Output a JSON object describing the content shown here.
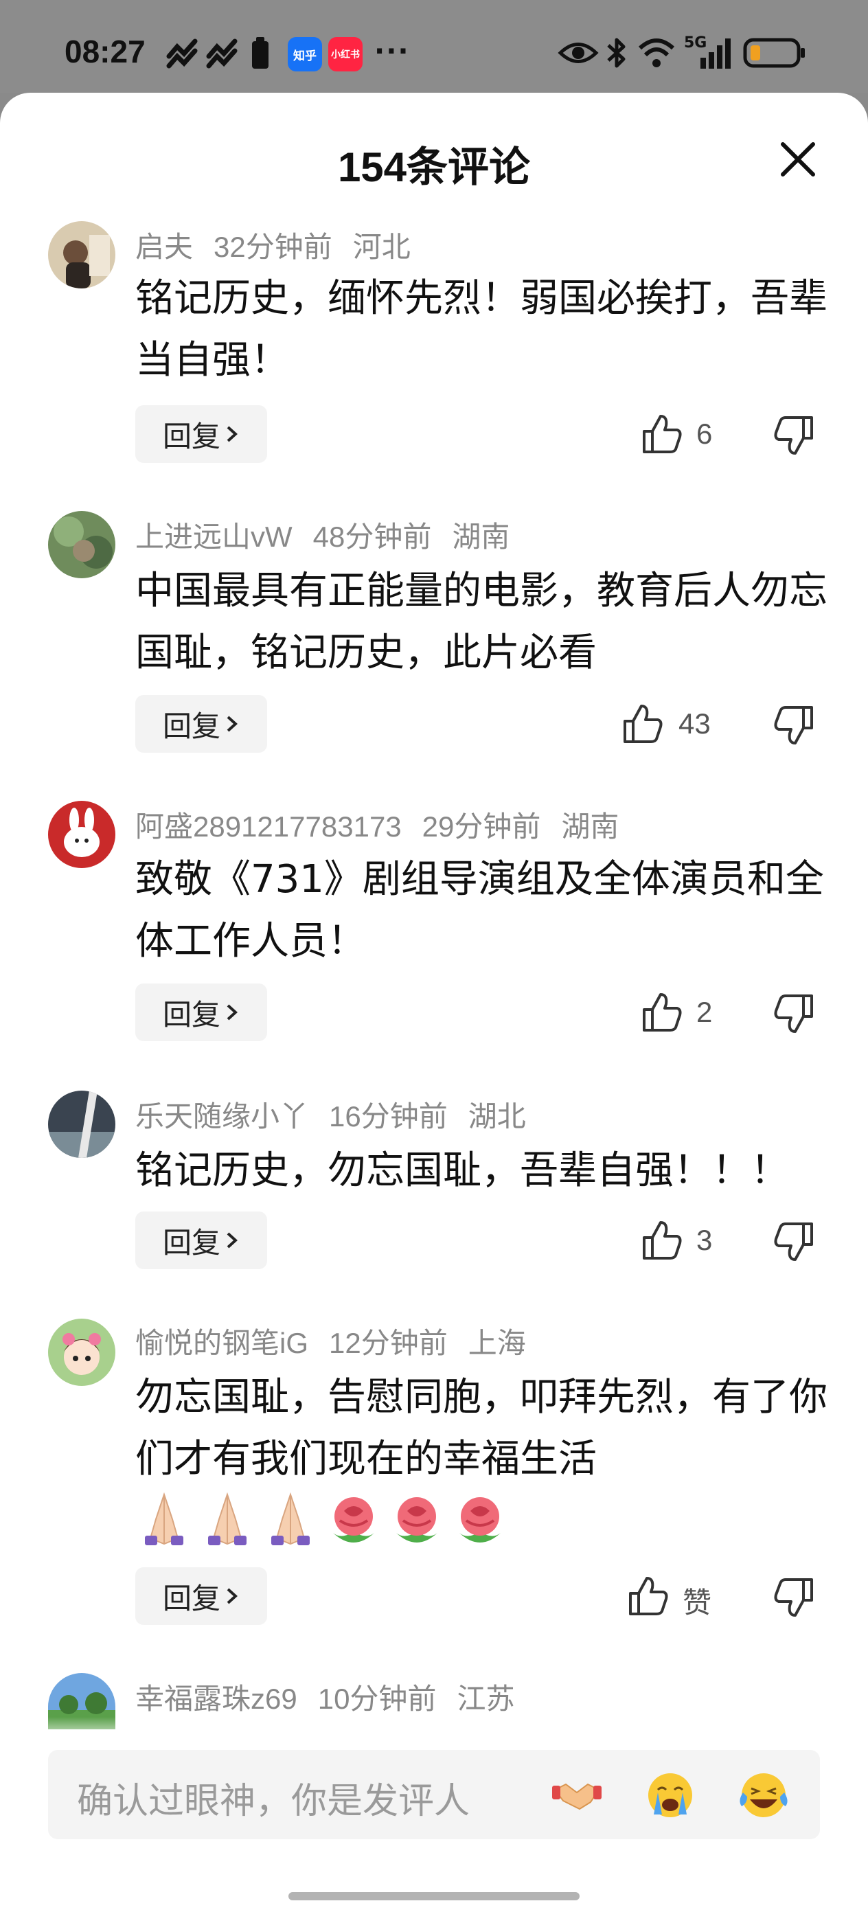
{
  "status_bar": {
    "time": "08:27",
    "badges": [
      {
        "label": "知乎",
        "color": "#1772f6"
      },
      {
        "label": "小红书",
        "color": "#ff2442"
      }
    ],
    "more": "···",
    "icons": [
      "eye-icon",
      "bluetooth-icon",
      "wifi-icon",
      "signal-5g-icon",
      "battery-icon"
    ],
    "network": "5G"
  },
  "sheet": {
    "title": "154条评论"
  },
  "comments": [
    {
      "user": "启夫",
      "time": "32分钟前",
      "region": "河北",
      "text": "铭记历史，缅怀先烈！弱国必挨打，吾辈当自强！",
      "reply_label": "回复",
      "likes": "6"
    },
    {
      "user": "上进远山vW",
      "time": "48分钟前",
      "region": "湖南",
      "text": "中国最具有正能量的电影，教育后人勿忘国耻，铭记历史，此片必看",
      "reply_label": "回复",
      "likes": "43"
    },
    {
      "user": "阿盛2891217783173",
      "time": "29分钟前",
      "region": "湖南",
      "text": "致敬《731》剧组导演组及全体演员和全体工作人员！",
      "reply_label": "回复",
      "likes": "2"
    },
    {
      "user": "乐天随缘小丫",
      "time": "16分钟前",
      "region": "湖北",
      "text": "铭记历史，勿忘国耻，吾辈自强！！！",
      "reply_label": "回复",
      "likes": "3"
    },
    {
      "user": "愉悦的钢笔iG",
      "time": "12分钟前",
      "region": "上海",
      "text": "勿忘国耻，告慰同胞，叩拜先烈，有了你们才有我们现在的幸福生活",
      "emojis": [
        "praying-hands",
        "praying-hands",
        "praying-hands",
        "rose",
        "rose",
        "rose"
      ],
      "reply_label": "回复",
      "likes": "赞"
    },
    {
      "user": "幸福露珠z69",
      "time": "10分钟前",
      "region": "江苏"
    }
  ],
  "input": {
    "placeholder": "确认过眼神，你是发评人",
    "quick_emojis": [
      "handshake-emoji",
      "crying-face-emoji",
      "laughing-tears-emoji"
    ]
  },
  "colors": {
    "sheet_bg": "#ffffff",
    "overlay": "#8c8c8c",
    "meta_text": "#888888"
  }
}
